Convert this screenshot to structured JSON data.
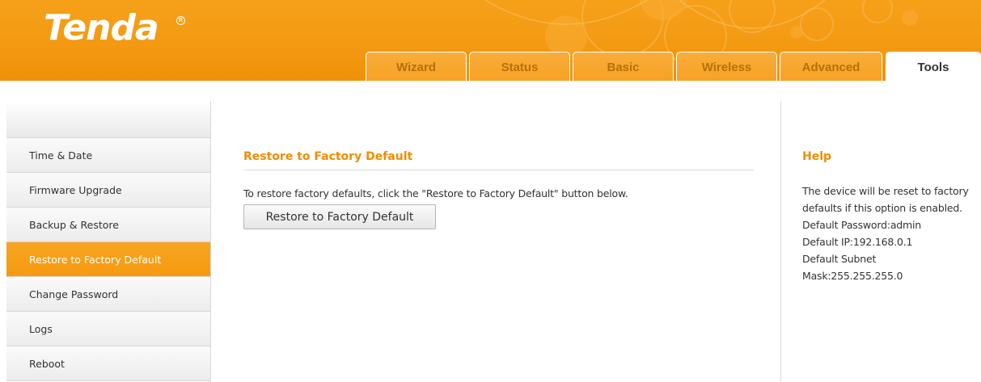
{
  "header": {
    "logo": "Tenda",
    "registered_mark": "R",
    "tabs": [
      {
        "label": "Wizard",
        "active": false
      },
      {
        "label": "Status",
        "active": false
      },
      {
        "label": "Basic",
        "active": false
      },
      {
        "label": "Wireless",
        "active": false
      },
      {
        "label": "Advanced",
        "active": false
      },
      {
        "label": "Tools",
        "active": true
      }
    ]
  },
  "sidebar": {
    "items": [
      {
        "label": "Time & Date",
        "active": false
      },
      {
        "label": "Firmware Upgrade",
        "active": false
      },
      {
        "label": "Backup & Restore",
        "active": false
      },
      {
        "label": "Restore to Factory Default",
        "active": true
      },
      {
        "label": "Change Password",
        "active": false
      },
      {
        "label": "Logs",
        "active": false
      },
      {
        "label": "Reboot",
        "active": false
      }
    ]
  },
  "main": {
    "title": "Restore to Factory Default",
    "description": "To restore factory defaults, click the \"Restore to Factory Default\" button below.",
    "button_label": "Restore to Factory Default"
  },
  "help": {
    "title": "Help",
    "lines": [
      "The device will be reset to factory defaults if this option is enabled.",
      "Default Password:admin",
      "Default IP:192.168.0.1",
      "Default Subnet Mask:255.255.255.0"
    ]
  },
  "colors": {
    "brand_orange": "#f39a12",
    "accent_text": "#f28c00",
    "active_nav": "#f59a10"
  }
}
